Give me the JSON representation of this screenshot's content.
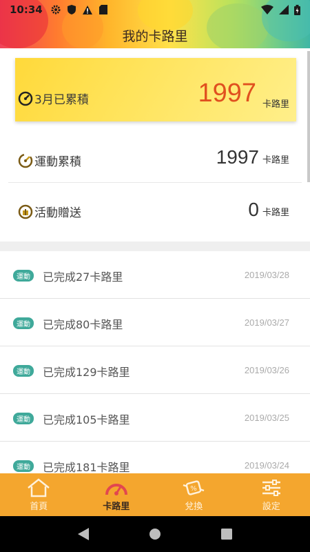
{
  "status": {
    "time": "10:34"
  },
  "header": {
    "title": "我的卡路里"
  },
  "summary": {
    "month": {
      "label": "3月已累積",
      "value": "1997",
      "unit": "卡路里"
    },
    "sport": {
      "label": "運動累積",
      "value": "1997",
      "unit": "卡路里"
    },
    "gift": {
      "label": "活動贈送",
      "value": "0",
      "unit": "卡路里"
    }
  },
  "records": [
    {
      "tag": "運動",
      "text": "已完成27卡路里",
      "date": "2019/03/28"
    },
    {
      "tag": "運動",
      "text": "已完成80卡路里",
      "date": "2019/03/27"
    },
    {
      "tag": "運動",
      "text": "已完成129卡路里",
      "date": "2019/03/26"
    },
    {
      "tag": "運動",
      "text": "已完成105卡路里",
      "date": "2019/03/25"
    },
    {
      "tag": "運動",
      "text": "已完成181卡路里",
      "date": "2019/03/24"
    }
  ],
  "nav": [
    {
      "label": "首頁",
      "icon": "home-icon"
    },
    {
      "label": "卡路里",
      "icon": "calorie-icon"
    },
    {
      "label": "兌換",
      "icon": "exchange-icon"
    },
    {
      "label": "設定",
      "icon": "settings-icon"
    }
  ],
  "colors": {
    "accent": "#f4a62e",
    "highlight": "#e0501f",
    "tag": "#3fa99a"
  }
}
